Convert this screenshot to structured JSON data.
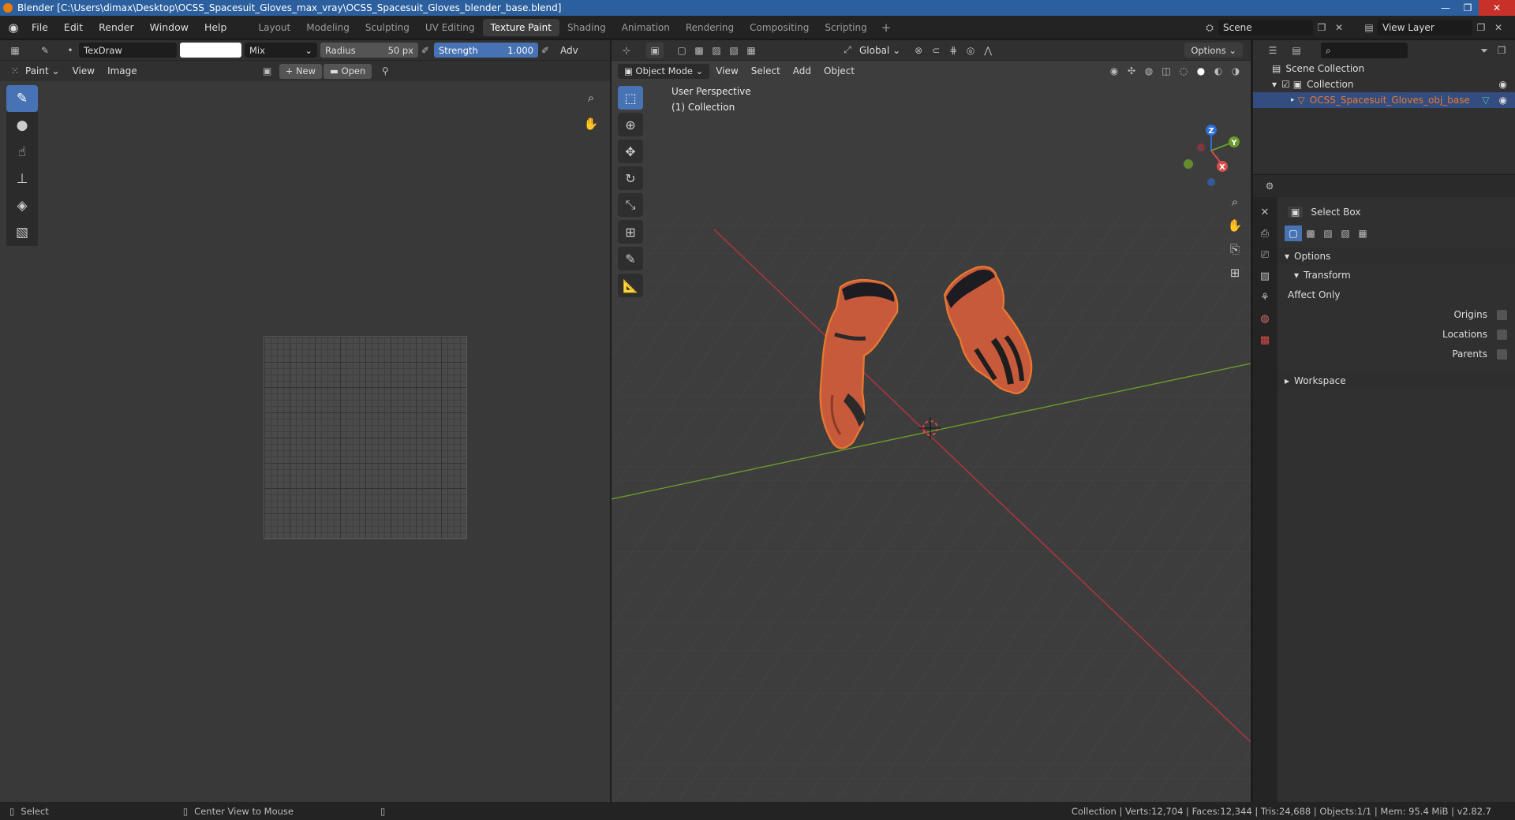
{
  "window": {
    "title": "Blender [C:\\Users\\dimax\\Desktop\\OCSS_Spacesuit_Gloves_max_vray\\OCSS_Spacesuit_Gloves_blender_base.blend]",
    "controls": [
      "—",
      "❐",
      "✕"
    ]
  },
  "menu": {
    "items": [
      "File",
      "Edit",
      "Render",
      "Window",
      "Help"
    ],
    "workspaces": [
      "Layout",
      "Modeling",
      "Sculpting",
      "UV Editing",
      "Texture Paint",
      "Shading",
      "Animation",
      "Rendering",
      "Compositing",
      "Scripting"
    ],
    "active_workspace": "Texture Paint",
    "scene": "Scene",
    "view_layer": "View Layer"
  },
  "image_editor": {
    "brush_name": "TexDraw",
    "blend_mode": "Mix",
    "radius_label": "Radius",
    "radius_value": "50 px",
    "strength_label": "Strength",
    "strength_value": "1.000",
    "adv_label": "Adv",
    "mode": "Paint",
    "view_menu": "View",
    "image_menu": "Image",
    "new_label": "New",
    "open_label": "Open"
  },
  "viewport": {
    "mode": "Object Mode",
    "menus": [
      "View",
      "Select",
      "Add",
      "Object"
    ],
    "orientation": "Global",
    "options_label": "Options",
    "perspective_label": "User Perspective",
    "collection_label": "(1) Collection",
    "axis_labels": {
      "x": "X",
      "y": "Y",
      "z": "Z"
    }
  },
  "outliner": {
    "scene_collection": "Scene Collection",
    "collection": "Collection",
    "object": "OCSS_Spacesuit_Gloves_obj_base"
  },
  "properties": {
    "tool_name": "Select Box",
    "options_header": "Options",
    "transform_header": "Transform",
    "affect_only": "Affect Only",
    "origins": "Origins",
    "locations": "Locations",
    "parents": "Parents",
    "workspace_header": "Workspace"
  },
  "status": {
    "left_action": "Select",
    "middle_action": "Center View to Mouse",
    "stats": "Collection | Verts:12,704 | Faces:12,344 | Tris:24,688 | Objects:1/1 | Mem: 95.4 MiB | v2.82.7"
  },
  "colors": {
    "accent_blue": "#4772b3",
    "selection_orange": "#e8792f",
    "glove_red": "#c85a3c",
    "axis_red": "#b8343f",
    "axis_green": "#6a9b2a"
  }
}
